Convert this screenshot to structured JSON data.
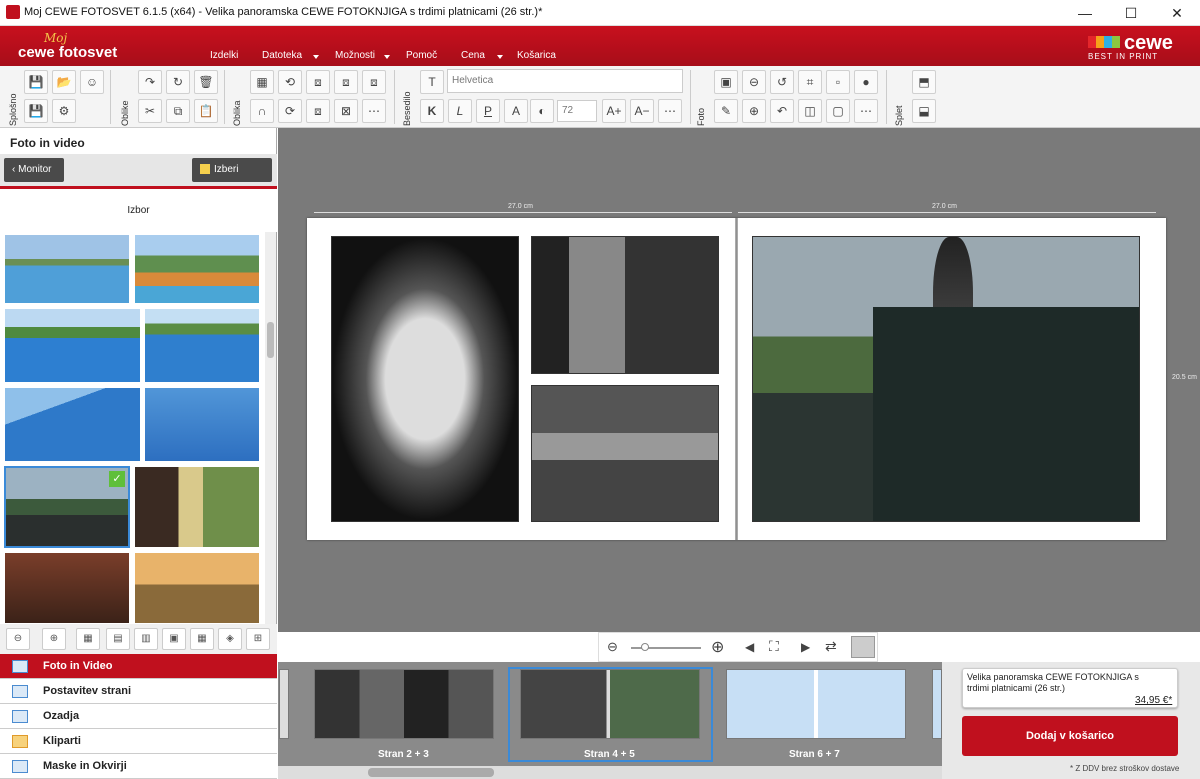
{
  "window": {
    "title": "Moj CEWE FOTOSVET 6.1.5 (x64) - Velika panoramska CEWE FOTOKNJIGA s trdimi platnicami (26 str.)*",
    "controls": {
      "minimize": "—",
      "maximize": "☐",
      "close": "✕"
    }
  },
  "brand": {
    "moj": "Moj",
    "name": "cewe fotosvet",
    "cewe": "cewe",
    "tagline": "BEST IN PRINT"
  },
  "menu": [
    {
      "label": "Izdelki"
    },
    {
      "label": "Datoteka"
    },
    {
      "label": "Možnosti"
    },
    {
      "label": "Pomoč"
    },
    {
      "label": "Cena"
    },
    {
      "label": "Košarica"
    }
  ],
  "toolbar": {
    "groups": [
      "Splošno",
      "Oblike",
      "Oblika",
      "Besedilo",
      "Foto",
      "Splet"
    ],
    "font": "Helvetica",
    "font_size": "72"
  },
  "left_panel": {
    "title": "Foto in video",
    "back_button": "Monitor",
    "folder_button": "Izberi mapo",
    "selection_label": "Izbor",
    "accordion": [
      {
        "label": "Foto in Video",
        "icon": "photo-icon",
        "active": true
      },
      {
        "label": "Postavitev strani",
        "icon": "layout-icon",
        "active": false
      },
      {
        "label": "Ozadja",
        "icon": "background-icon",
        "active": false
      },
      {
        "label": "Kliparti",
        "icon": "clipart-icon",
        "active": false
      },
      {
        "label": "Maske in Okvirji",
        "icon": "mask-frame-icon",
        "active": false
      }
    ]
  },
  "canvas": {
    "left_width_label": "27.0 cm",
    "right_width_label": "27.0 cm",
    "height_label": "20.5 cm"
  },
  "filmstrip": {
    "pages": [
      {
        "label": "Stran 2 + 3"
      },
      {
        "label": "Stran 4 + 5",
        "selected": true
      },
      {
        "label": "Stran 6 + 7"
      }
    ]
  },
  "cart": {
    "product": "Velika panoramska CEWE FOTOKNJIGA s trdimi platnicami (26 str.)",
    "price": "34,95 €*",
    "add_button": "Dodaj v košarico",
    "note": "* Z DDV brez stroškov dostave"
  },
  "colors": {
    "brand_red": "#c0101e",
    "selection_blue": "#3a8ad8"
  }
}
